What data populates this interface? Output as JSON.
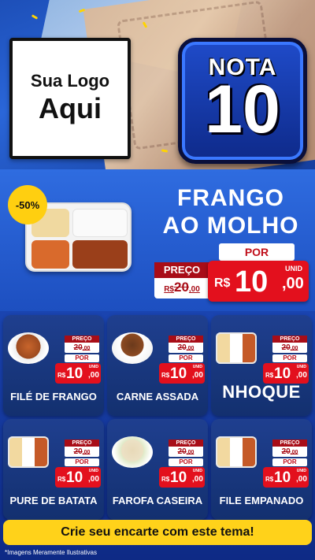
{
  "header": {
    "logo_line1": "Sua Logo",
    "logo_line2": "Aqui",
    "badge_word": "NOTA",
    "badge_number": "10"
  },
  "featured": {
    "discount": "-50%",
    "title_line1": "FRANGO",
    "title_line2": "AO MOLHO",
    "por_label": "POR",
    "preco_label": "PREÇO",
    "old_price_prefix": "R$",
    "old_price": "20",
    "old_price_cents": ",00",
    "unit_label": "UNID",
    "currency": "R$",
    "price_int": "10",
    "price_cents": ",00"
  },
  "cards": [
    {
      "name": "FILÉ DE FRANGO",
      "preco_label": "PREÇO",
      "old_price": "20",
      "old_cents": ",00",
      "por_label": "POR",
      "unit_label": "UNID",
      "currency": "R$",
      "price_int": "10",
      "price_cents": ",00",
      "image": "plate"
    },
    {
      "name": "CARNE ASSADA",
      "preco_label": "PREÇO",
      "old_price": "20",
      "old_cents": ",00",
      "por_label": "POR",
      "unit_label": "UNID",
      "currency": "R$",
      "price_int": "10",
      "price_cents": ",00",
      "image": "bowl"
    },
    {
      "name": "NHOQUE",
      "preco_label": "PREÇO",
      "old_price": "20",
      "old_cents": ",00",
      "por_label": "POR",
      "unit_label": "UNID",
      "currency": "R$",
      "price_int": "10",
      "price_cents": ",00",
      "image": "tray"
    },
    {
      "name": "PURE DE BATATA",
      "preco_label": "PREÇO",
      "old_price": "20",
      "old_cents": ",00",
      "por_label": "POR",
      "unit_label": "UNID",
      "currency": "R$",
      "price_int": "10",
      "price_cents": ",00",
      "image": "tray"
    },
    {
      "name": "FAROFA CASEIRA",
      "preco_label": "PREÇO",
      "old_price": "20",
      "old_cents": ",00",
      "por_label": "POR",
      "unit_label": "UNID",
      "currency": "R$",
      "price_int": "10",
      "price_cents": ",00",
      "image": "rice"
    },
    {
      "name": "FILE EMPANADO",
      "preco_label": "PREÇO",
      "old_price": "20",
      "old_cents": ",00",
      "por_label": "POR",
      "unit_label": "UNID",
      "currency": "R$",
      "price_int": "10",
      "price_cents": ",00",
      "image": "tray"
    }
  ],
  "footer": {
    "cta": "Crie seu encarte com este tema!",
    "disclaimer": "*Imagens Meramente Ilustrativas"
  },
  "colors": {
    "background_blue": "#1d4fc0",
    "price_red": "#e3101d",
    "old_price_red": "#a80d17",
    "cta_yellow": "#ffd21a",
    "discount_yellow": "#ffcf10"
  }
}
